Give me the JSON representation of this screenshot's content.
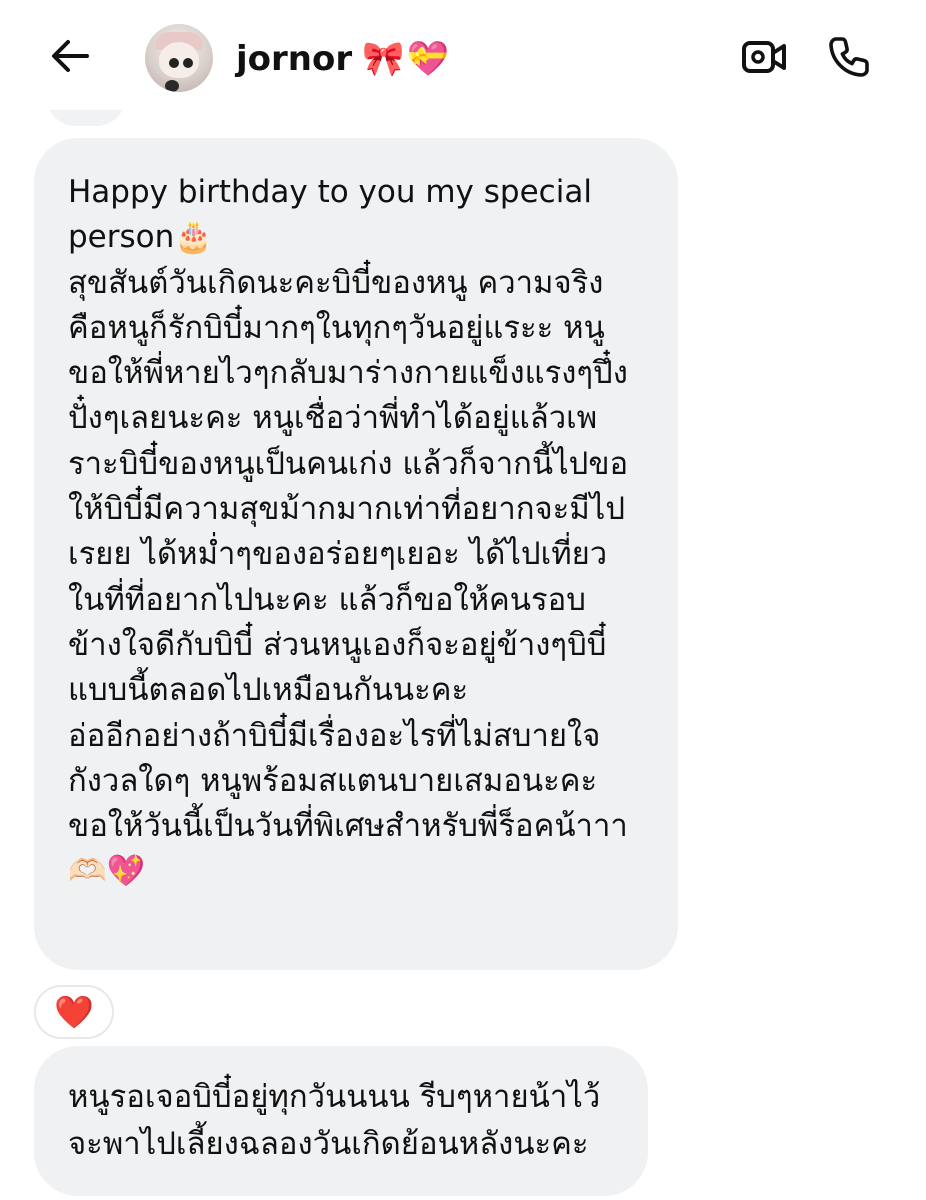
{
  "header": {
    "username": "jornor",
    "username_emojis": "🎀💝",
    "back_icon": "arrow-left-icon",
    "video_icon": "video-camera-icon",
    "call_icon": "phone-icon"
  },
  "messages": [
    {
      "text": "Happy birthday to you my special\nperson🎂\nสุขสันต์วันเกิดนะคะบิบี๋ของหนู ความจริง\nคือหนูก็รักบิบี๋มากๆในทุกๆวันอยู่แระะ หนู\nขอให้พี่หายไวๆกลับมาร่างกายแข็งแรงๆปึ๋ง\nปั๋งๆเลยนะคะ หนูเชื่อว่าพี่ทำได้อยู่แล้วเพ\nราะบิบี๋ของหนูเป็นคนเก่ง แล้วก็จากนี้ไปขอ\nให้บิบี๋มีความสุขม้ากมากเท่าที่อยากจะมีไป\nเรยย ได้หม่ำๆของอร่อยๆเยอะ ได้ไปเที่ยว\nในที่ที่อยากไปนะคะ แล้วก็ขอให้คนรอบ\nข้างใจดีกับบิบี๋ ส่วนหนูเองก็จะอยู่ข้างๆบิบี๋\nแบบนี้ตลอดไปเหมือนกันนะคะ\nอ่ออีกอย่างถ้าบิบี๋มีเรื่องอะไรที่ไม่สบายใจ\nกังวลใดๆ หนูพร้อมสแตนบายเสมอนะคะ\nขอให้วันนี้เป็นวันที่พิเศษสำหรับพี่ร็อคน้าาา\n🫶🏻💖",
      "reaction": "❤️"
    },
    {
      "text": "หนูรอเจอบิบี๋อยู่ทุกวันนนน รีบๆหายน้าไว้\nจะพาไปเลี้ยงฉลองวันเกิดย้อนหลังนะคะ"
    }
  ]
}
